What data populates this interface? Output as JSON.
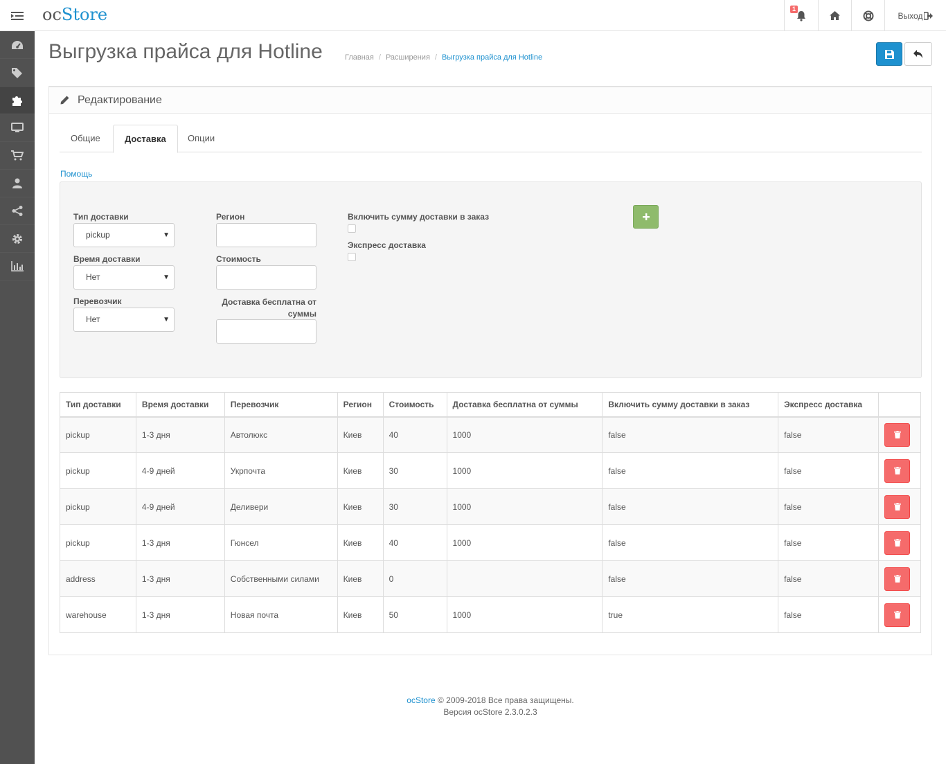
{
  "header": {
    "logo_prefix": "oc",
    "logo_suffix": "Store",
    "notifications_count": "1",
    "logout_label": "Выход"
  },
  "sidebar": {
    "items": [
      {
        "icon": "dashboard-icon"
      },
      {
        "icon": "tags-icon"
      },
      {
        "icon": "puzzle-icon"
      },
      {
        "icon": "desktop-icon"
      },
      {
        "icon": "cart-icon"
      },
      {
        "icon": "user-icon"
      },
      {
        "icon": "share-icon"
      },
      {
        "icon": "cog-icon"
      },
      {
        "icon": "bar-chart-icon"
      }
    ]
  },
  "page": {
    "title": "Выгрузка прайса для Hotline",
    "breadcrumb": [
      "Главная",
      "Расширения",
      "Выгрузка прайса для Hotline"
    ]
  },
  "panel": {
    "title": "Редактирование",
    "tabs": [
      "Общие",
      "Доставка",
      "Опции"
    ],
    "active_tab": "Доставка",
    "help_link": "Помощь"
  },
  "form": {
    "delivery_type_label": "Тип доставки",
    "delivery_type_value": "pickup",
    "delivery_time_label": "Время доставки",
    "delivery_time_value": "Нет",
    "carrier_label": "Перевозчик",
    "carrier_value": "Нет",
    "region_label": "Регион",
    "cost_label": "Стоимость",
    "free_from_label": "Доставка бесплатна от суммы",
    "include_sum_label": "Включить сумму доставки в заказ",
    "express_label": "Экспресс доставка"
  },
  "table": {
    "headers": [
      "Тип доставки",
      "Время доставки",
      "Перевозчик",
      "Регион",
      "Стоимость",
      "Доставка бесплатна от суммы",
      "Включить сумму доставки в заказ",
      "Экспресс доставка"
    ],
    "rows": [
      [
        "pickup",
        "1-3 дня",
        "Автолюкс",
        "Киев",
        "40",
        "1000",
        "false",
        "false"
      ],
      [
        "pickup",
        "4-9 дней",
        "Укрпочта",
        "Киев",
        "30",
        "1000",
        "false",
        "false"
      ],
      [
        "pickup",
        "4-9 дней",
        "Деливери",
        "Киев",
        "30",
        "1000",
        "false",
        "false"
      ],
      [
        "pickup",
        "1-3 дня",
        "Гюнсел",
        "Киев",
        "40",
        "1000",
        "false",
        "false"
      ],
      [
        "address",
        "1-3 дня",
        "Собственными силами",
        "Киев",
        "0",
        "",
        "false",
        "false"
      ],
      [
        "warehouse",
        "1-3 дня",
        "Новая почта",
        "Киев",
        "50",
        "1000",
        "true",
        "false"
      ]
    ]
  },
  "footer": {
    "brand": "ocStore",
    "copyright": "© 2009-2018 Все права защищены.",
    "version": "Версия ocStore 2.3.0.2.3"
  },
  "colors": {
    "primary": "#1e91cf",
    "success": "#8fbb6c",
    "danger": "#f56b6b",
    "sidebar": "#515151"
  }
}
